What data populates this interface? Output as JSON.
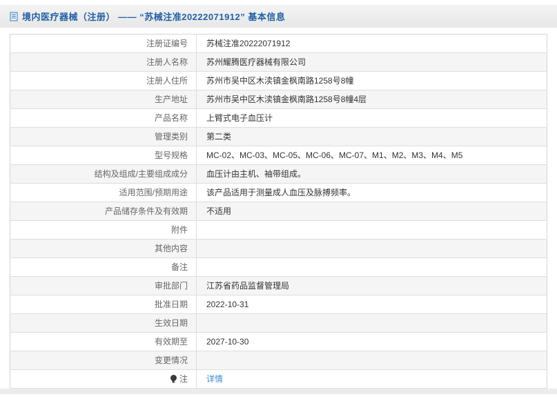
{
  "header": {
    "title": "境内医疗器械（注册） —— “苏械注准20222071912” 基本信息",
    "icon": "document-icon"
  },
  "table": {
    "rows": [
      {
        "label": "注册证编号",
        "value": "苏械注准20222071912"
      },
      {
        "label": "注册人名称",
        "value": "苏州耀腾医疗器械有限公司"
      },
      {
        "label": "注册人住所",
        "value": "苏州市吴中区木渎镇金枫南路1258号8幢"
      },
      {
        "label": "生产地址",
        "value": "苏州市吴中区木渎镇金枫南路1258号8幢4层"
      },
      {
        "label": "产品名称",
        "value": "上臂式电子血压计"
      },
      {
        "label": "管理类别",
        "value": "第二类"
      },
      {
        "label": "型号规格",
        "value": "MC-02、MC-03、MC-05、MC-06、MC-07、M1、M2、M3、M4、M5"
      },
      {
        "label": "结构及组成/主要组成成分",
        "value": "血压计由主机、袖带组成。"
      },
      {
        "label": "适用范围/预期用途",
        "value": "该产品适用于测量成人血压及脉搏频率。"
      },
      {
        "label": "产品储存条件及有效期",
        "value": "不适用"
      },
      {
        "label": "附件",
        "value": ""
      },
      {
        "label": "其他内容",
        "value": ""
      },
      {
        "label": "备注",
        "value": ""
      },
      {
        "label": "审批部门",
        "value": "江苏省药品监督管理局"
      },
      {
        "label": "批准日期",
        "value": "2022-10-31"
      },
      {
        "label": "生效日期",
        "value": ""
      },
      {
        "label": "有效期至",
        "value": "2027-10-30"
      },
      {
        "label": "变更情况",
        "value": ""
      },
      {
        "label": "注",
        "value": "详情",
        "link": true,
        "label_icon": "note-icon"
      }
    ]
  },
  "colors": {
    "title_blue": "#2160a5",
    "link_blue": "#3b8dd4",
    "alt_row_bg": "#f5f5f5",
    "table_border": "#d4d4d4",
    "header_bar_bg": "#ececec"
  }
}
